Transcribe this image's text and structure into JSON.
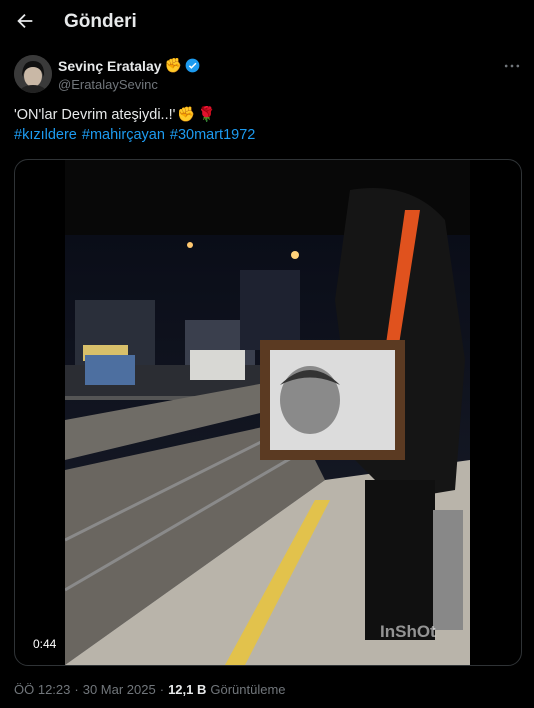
{
  "header": {
    "title": "Gönderi"
  },
  "author": {
    "name": "Sevinç Eratalay",
    "handle": "@EratalaySevinc"
  },
  "tweet": {
    "text": "'ON'lar Devrim ateşiydi..!'",
    "hashtags": [
      "#kızıldere",
      "#mahirçayan",
      "#30mart1972"
    ]
  },
  "media": {
    "duration": "0:44",
    "watermark": "InShOt"
  },
  "meta": {
    "time": "ÖÖ 12:23",
    "separator": "·",
    "date": "30 Mar 2025",
    "views_count": "12,1 B",
    "views_label": "Görüntüleme"
  },
  "colors": {
    "link": "#1d9bf0",
    "verified": "#1d9bf0",
    "muted": "#71767b"
  },
  "icons": {
    "back": "arrow-left-icon",
    "verified": "verified-badge-icon",
    "more": "more-dots-icon"
  }
}
